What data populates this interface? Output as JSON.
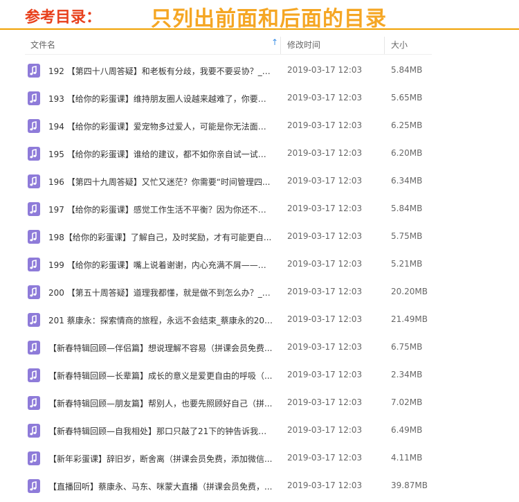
{
  "banner": {
    "reference": "参考目录：",
    "note": "只列出前面和后面的目录"
  },
  "header": {
    "name": "文件名",
    "modified": "修改时间",
    "size": "大小"
  },
  "colors": {
    "icon": "#8e7bd9",
    "accent": "#f0a000",
    "sort": "#3a8ee6"
  },
  "files": [
    {
      "name": "192 【第四十八周答疑】和老板有分歧，我要不要妥协？_（...",
      "date": "2019-03-17 12:03",
      "size": "5.84MB"
    },
    {
      "name": "193 【给你的彩蛋课】维持朋友圈人设越来越难了，你要继...",
      "date": "2019-03-17 12:03",
      "size": "5.65MB"
    },
    {
      "name": "194 【给你的彩蛋课】爱宠物多过爱人，可能是你无法面对...",
      "date": "2019-03-17 12:03",
      "size": "6.25MB"
    },
    {
      "name": "195 【给你的彩蛋课】谁给的建议，都不如你亲自试一试—...",
      "date": "2019-03-17 12:03",
      "size": "6.20MB"
    },
    {
      "name": "196 【第四十九周答疑】又忙又迷茫？你需要“时间管理四...",
      "date": "2019-03-17 12:03",
      "size": "6.34MB"
    },
    {
      "name": "197 【给你的彩蛋课】感觉工作生活不平衡？因为你还不知...",
      "date": "2019-03-17 12:03",
      "size": "5.84MB"
    },
    {
      "name": "198【给你的彩蛋课】了解自己，及时奖励，才有可能更自...",
      "date": "2019-03-17 12:03",
      "size": "5.75MB"
    },
    {
      "name": "199 【给你的彩蛋课】嘴上说着谢谢，内心充满不屑——生...",
      "date": "2019-03-17 12:03",
      "size": "5.21MB"
    },
    {
      "name": "200 【第五十周答疑】道理我都懂，就是做不到怎么办？_蔡...",
      "date": "2019-03-17 12:03",
      "size": "20.20MB"
    },
    {
      "name": "201 蔡康永：探索情商的旅程，永远不会结束_蔡康永的201...",
      "date": "2019-03-17 12:03",
      "size": "21.49MB"
    },
    {
      "name": "【新春特辑回顾—伴侣篇】想说理解不容易（拼课会员免费...",
      "date": "2019-03-17 12:03",
      "size": "6.75MB"
    },
    {
      "name": "【新春特辑回顾—长辈篇】成长的意义是爱更自由的呼吸（...",
      "date": "2019-03-17 12:03",
      "size": "2.34MB"
    },
    {
      "name": "【新春特辑回顾—朋友篇】帮别人，也要先照顾好自己（拼...",
      "date": "2019-03-17 12:03",
      "size": "7.02MB"
    },
    {
      "name": "【新春特辑回顾—自我相处】那口只敲了21下的钟告诉我的...",
      "date": "2019-03-17 12:03",
      "size": "6.49MB"
    },
    {
      "name": "【新年彩蛋课】辞旧岁，断舍离（拼课会员免费，添加微信...",
      "date": "2019-03-17 12:03",
      "size": "4.11MB"
    },
    {
      "name": "【直播回听】蔡康永、马东、咪蒙大直播（拼课会员免费，...",
      "date": "2019-03-17 12:03",
      "size": "39.87MB"
    }
  ]
}
